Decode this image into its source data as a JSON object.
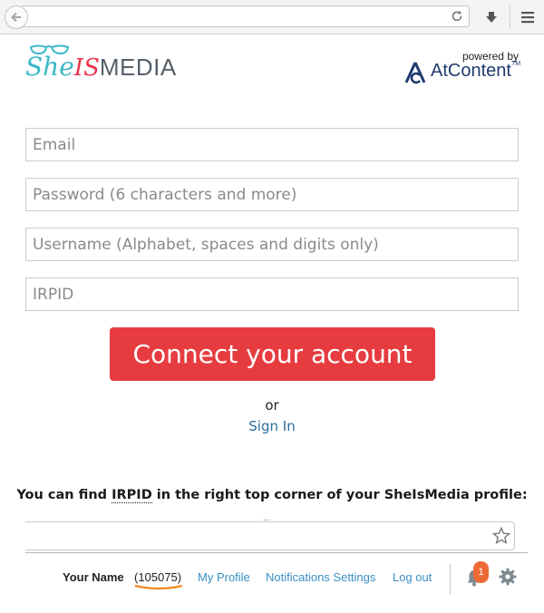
{
  "browser": {
    "back_icon": "back-arrow-icon",
    "reload_icon": "reload-icon",
    "download_icon": "download-arrow-icon",
    "menu_icon": "hamburger-menu-icon"
  },
  "header": {
    "logo_she": "She",
    "logo_is": "IS",
    "logo_media": "MEDIA",
    "powered_by": "powered by",
    "partner_name": "AtContent",
    "partner_tm": "TM"
  },
  "form": {
    "email_placeholder": "Email",
    "password_placeholder": "Password (6 characters and more)",
    "username_placeholder": "Username (Alphabet, spaces and digits only)",
    "irpid_placeholder": "IRPID",
    "connect_label": "Connect your account",
    "or_label": "or",
    "sign_in_label": "Sign In"
  },
  "hint": {
    "prefix": "You can find ",
    "keyword": "IRPID",
    "suffix": " in the right top corner of your SheIsMedia profile:"
  },
  "snapshot": {
    "dots": "...",
    "user_name": "Your Name",
    "user_id": "(105075)",
    "link_profile": "My Profile",
    "link_notifications": "Notifications Settings",
    "link_logout": "Log out",
    "notification_count": "1"
  },
  "colors": {
    "brand_teal": "#3cb8c7",
    "brand_red": "#e8334b",
    "button_red": "#e63c40",
    "link_blue": "#2e6d9b",
    "partner_blue": "#1f3a70",
    "badge_orange": "#ee6a35"
  }
}
